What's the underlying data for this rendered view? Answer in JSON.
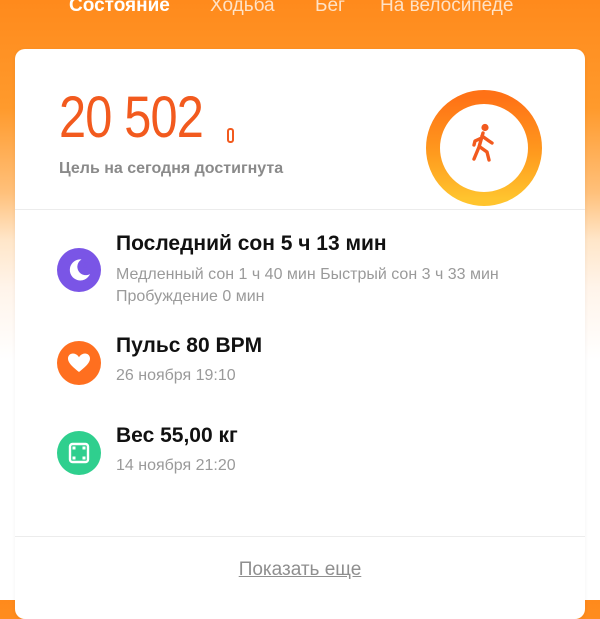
{
  "tabs": [
    {
      "label": "Состояние",
      "active": true
    },
    {
      "label": "Ходьба",
      "active": false
    },
    {
      "label": "Бег",
      "active": false
    },
    {
      "label": "На велосипеде",
      "active": false
    }
  ],
  "summary": {
    "steps": "20 502",
    "goal_status": "Цель на сегодня достигнута",
    "ring_icon": "walking-person-icon",
    "band_icon": "fitness-band-icon",
    "goal_progress": 1.0
  },
  "items": [
    {
      "icon": "sleep-moon-icon",
      "title": "Последний сон 5 ч 13 мин",
      "subtitle": "Медленный сон 1 ч 40 мин  Быстрый сон 3 ч 33 мин  Пробуждение 0 мин"
    },
    {
      "icon": "heart-icon",
      "title": "Пульс 80 BPM",
      "subtitle": "26 ноября 19:10"
    },
    {
      "icon": "scale-icon",
      "title": "Вес 55,00 кг",
      "subtitle": "14 ноября 21:20"
    }
  ],
  "show_more": "Показать еще",
  "colors": {
    "accent_orange": "#f25a1e",
    "sleep_purple": "#7a55e6",
    "pulse_orange": "#ff6f1f",
    "weight_green": "#2fcf8e",
    "ring_outer": "#ff7a1a",
    "ring_inner": "#ffc22e"
  }
}
